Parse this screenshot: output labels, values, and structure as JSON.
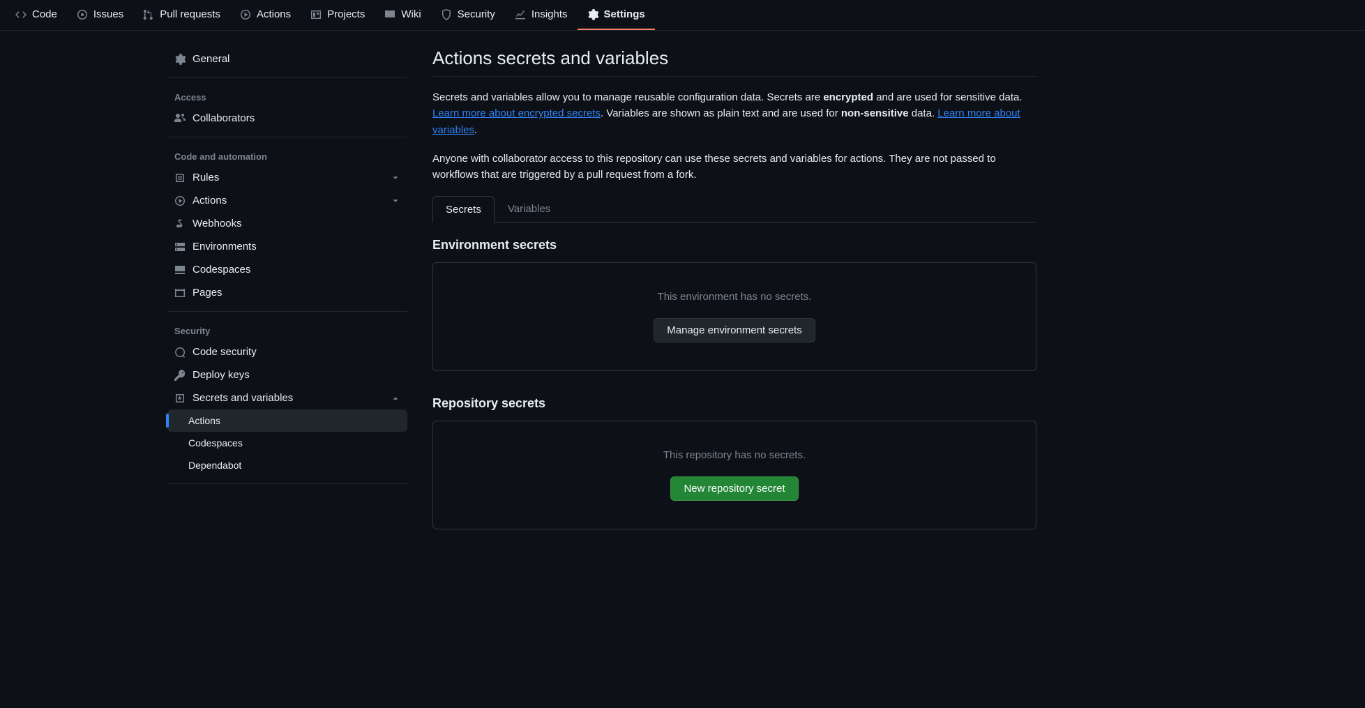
{
  "topnav": [
    {
      "label": "Code"
    },
    {
      "label": "Issues"
    },
    {
      "label": "Pull requests"
    },
    {
      "label": "Actions"
    },
    {
      "label": "Projects"
    },
    {
      "label": "Wiki"
    },
    {
      "label": "Security"
    },
    {
      "label": "Insights"
    },
    {
      "label": "Settings"
    }
  ],
  "sidebar": {
    "general": "General",
    "heading_access": "Access",
    "collaborators": "Collaborators",
    "heading_code": "Code and automation",
    "rules": "Rules",
    "actions": "Actions",
    "webhooks": "Webhooks",
    "environments": "Environments",
    "codespaces": "Codespaces",
    "pages": "Pages",
    "heading_security": "Security",
    "code_security": "Code security",
    "deploy_keys": "Deploy keys",
    "secrets_vars": "Secrets and variables",
    "sub_actions": "Actions",
    "sub_codespaces": "Codespaces",
    "sub_dependabot": "Dependabot"
  },
  "main": {
    "title": "Actions secrets and variables",
    "desc_part1": "Secrets and variables allow you to manage reusable configuration data. Secrets are ",
    "desc_strong1": "encrypted",
    "desc_part2": " and are used for sensitive data. ",
    "desc_link1": "Learn more about encrypted secrets",
    "desc_part3": ". Variables are shown as plain text and are used for ",
    "desc_strong2": "non-sensitive",
    "desc_part4": " data. ",
    "desc_link2": "Learn more about variables",
    "desc_part5": ".",
    "desc_para2": "Anyone with collaborator access to this repository can use these secrets and variables for actions. They are not passed to workflows that are triggered by a pull request from a fork.",
    "tab_secrets": "Secrets",
    "tab_variables": "Variables",
    "env_title": "Environment secrets",
    "env_empty": "This environment has no secrets.",
    "env_btn": "Manage environment secrets",
    "repo_title": "Repository secrets",
    "repo_empty": "This repository has no secrets.",
    "repo_btn": "New repository secret"
  }
}
